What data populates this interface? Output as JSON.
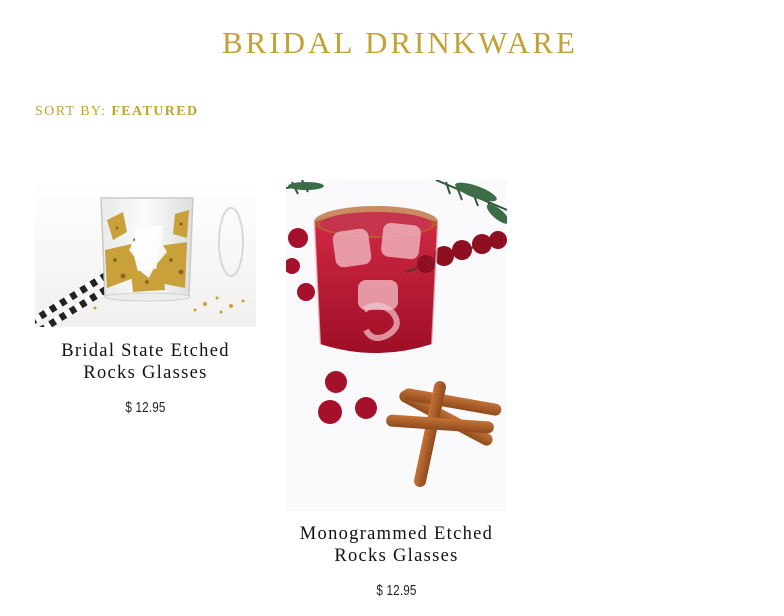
{
  "page": {
    "title": "BRIDAL DRINKWARE"
  },
  "sort": {
    "label": "SORT BY:",
    "value": "FEATURED"
  },
  "products": [
    {
      "name": "Bridal State Etched Rocks Glasses",
      "price": "$ 12.95",
      "image": "etched-rocks-glass-gold-confetti"
    },
    {
      "name": "Monogrammed Etched Rocks Glasses",
      "price": "$ 12.95",
      "image": "cranberry-cocktail-cinnamon-sticks"
    }
  ],
  "colors": {
    "accent_gold": "#c2a236",
    "text_dark": "#111111",
    "cocktail_red": "#b3122b",
    "cinnamon": "#a85a24"
  }
}
